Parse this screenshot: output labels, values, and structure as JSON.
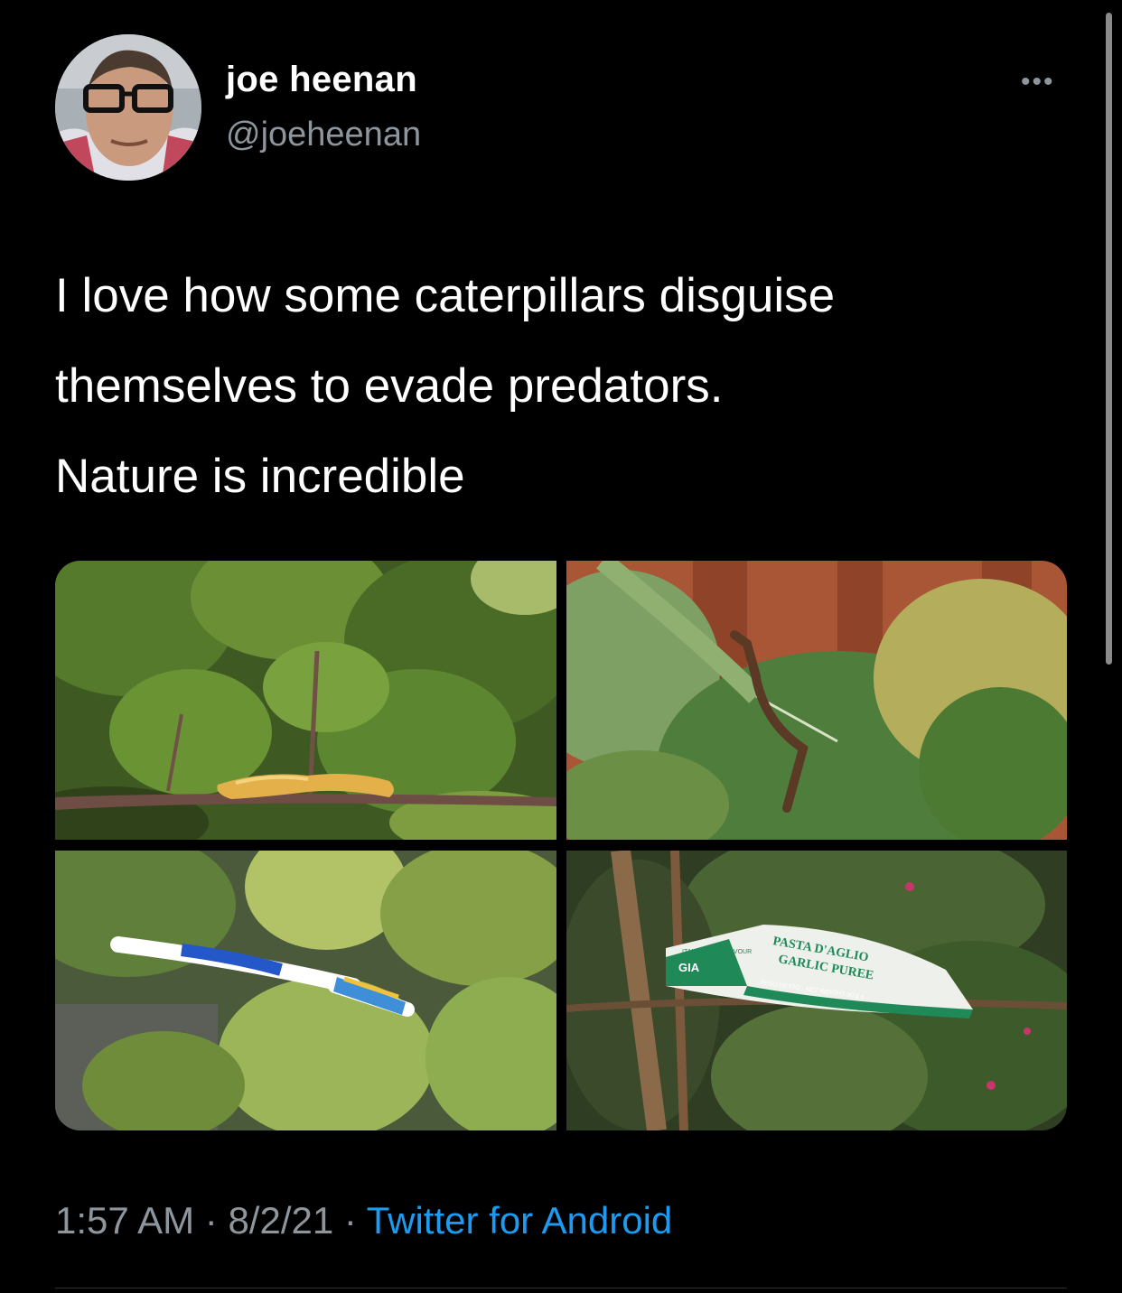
{
  "author": {
    "name": "joe heenan",
    "handle": "@joeheenan"
  },
  "tweet": {
    "lines": [
      "I love how some caterpillars disguise",
      "themselves to evade predators.",
      "Nature is incredible"
    ]
  },
  "media": [
    {
      "subject": "cheese puff on a twig"
    },
    {
      "subject": "bent metal allen key on a leaf"
    },
    {
      "subject": "toothbrush among leaves"
    },
    {
      "subject": "garlic puree tube on a branch",
      "tube_text": [
        "PASTA D'AGLIO",
        "GARLIC PUREE",
        "PESO NETTO - NET WEIGHT 90 g e",
        "GIA",
        "ITALIAN FOR FLAVOUR"
      ]
    }
  ],
  "meta": {
    "time": "1:57 AM",
    "sep1": " · ",
    "date": "8/2/21",
    "sep2": " · ",
    "source": "Twitter for Android"
  },
  "icons": {
    "more": "more-options-icon"
  },
  "colors": {
    "background": "#000000",
    "secondary_text": "#8e969d",
    "link": "#1d9bf0"
  }
}
